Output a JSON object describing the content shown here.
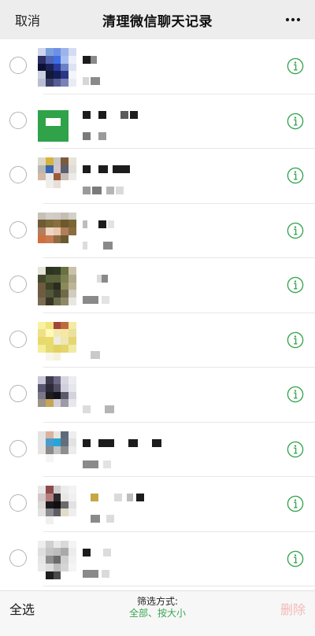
{
  "nav": {
    "cancel_label": "取消",
    "title": "清理微信聊天记录",
    "more_icon": "more-dots-icon"
  },
  "rows": [
    {
      "avatar": [
        "#cfd5ea",
        "#7aa0de",
        "#6f8fe6",
        "#9cb4ea",
        "#d4dcf4",
        "#2c2f62",
        "#5064b0",
        "#3d6ee8",
        "#a7bff0",
        "#edf0fa",
        "#0d1033",
        "#1b2256",
        "#2a3a9e",
        "#6a82c4",
        "#dde3f3",
        "#c9cfdf",
        "#131838",
        "#141d56",
        "#2b3784",
        "#f3f5fa",
        "#b8bfd4",
        "#3a3f68",
        "#565d93",
        "#7a82b6",
        "#e9ecf3"
      ],
      "name_blocks": [
        {
          "x": 0,
          "w": 10,
          "c": "#1c1c1c"
        },
        {
          "x": 10,
          "w": 8,
          "c": "#8a8a8a"
        }
      ],
      "sub_blocks": [
        {
          "x": 0,
          "w": 8,
          "c": "#d6d6d6"
        },
        {
          "x": 10,
          "w": 12,
          "c": "#8a8a8a"
        }
      ]
    },
    {
      "avatar": [
        "#ffffff",
        "#ffffff",
        "#ffffff",
        "#ffffff",
        "#ffffff",
        "#2fa24a",
        "#2fa24a",
        "#2fa24a",
        "#2fa24a",
        "#ffffff",
        "#2fa24a",
        "#ffffff",
        "#ffffff",
        "#2fa24a",
        "#ffffff",
        "#2fa24a",
        "#2fa24a",
        "#2fa24a",
        "#2fa24a",
        "#ffffff",
        "#2fa24a",
        "#2fa24a",
        "#2fa24a",
        "#2fa24a",
        "#ffffff"
      ],
      "name_blocks": [
        {
          "x": 0,
          "w": 10,
          "c": "#1c1c1c"
        },
        {
          "x": 20,
          "w": 10,
          "c": "#1c1c1c"
        },
        {
          "x": 48,
          "w": 10,
          "c": "#5a5a5a"
        },
        {
          "x": 60,
          "w": 10,
          "c": "#1c1c1c"
        }
      ],
      "sub_blocks": [
        {
          "x": 0,
          "w": 10,
          "c": "#7a7a7a"
        },
        {
          "x": 20,
          "w": 10,
          "c": "#9a9a9a"
        }
      ]
    },
    {
      "avatar": [
        "#ddd9c9",
        "#d8b33b",
        "#c7c6c9",
        "#7c5a3c",
        "#e7e3d9",
        "#b8b7b6",
        "#3767b0",
        "#d7c4c8",
        "#5b5f70",
        "#e0dcd6",
        "#d5b8a5",
        "#e8ebeb",
        "#9b5b3a",
        "#c9bfb9",
        "#ebebea",
        "#ffffff",
        "#f0eeea",
        "#e7dfd8",
        "#ffffff",
        "#ffffff",
        "#ffffff",
        "#ffffff",
        "#ffffff",
        "#ffffff",
        "#ffffff"
      ],
      "name_blocks": [
        {
          "x": 0,
          "w": 10,
          "c": "#1c1c1c"
        },
        {
          "x": 20,
          "w": 12,
          "c": "#1c1c1c"
        },
        {
          "x": 38,
          "w": 12,
          "c": "#1c1c1c"
        },
        {
          "x": 50,
          "w": 10,
          "c": "#1c1c1c"
        }
      ],
      "sub_blocks": [
        {
          "x": 0,
          "w": 10,
          "c": "#9a9a9a"
        },
        {
          "x": 12,
          "w": 12,
          "c": "#7a7a7a"
        },
        {
          "x": 30,
          "w": 10,
          "c": "#b5b5b5"
        },
        {
          "x": 42,
          "w": 10,
          "c": "#dadada"
        }
      ]
    },
    {
      "avatar": [
        "#c7c0b6",
        "#d2cdc6",
        "#cfcbc5",
        "#c6bdb2",
        "#d3d0ca",
        "#6e5a33",
        "#7a6a37",
        "#8b6e3e",
        "#6a5a2e",
        "#7a6533",
        "#b17e60",
        "#eed5c4",
        "#e8c8b0",
        "#b27d5b",
        "#8a6c40",
        "#d06e3e",
        "#c57b52",
        "#8e6b42",
        "#6b5a30",
        "#ffffff",
        "#ffffff",
        "#ffffff",
        "#ffffff",
        "#ffffff",
        "#ffffff"
      ],
      "name_blocks": [
        {
          "x": 0,
          "w": 6,
          "c": "#bdbdbd"
        },
        {
          "x": 20,
          "w": 10,
          "c": "#1c1c1c"
        },
        {
          "x": 32,
          "w": 8,
          "c": "#e3e3e3"
        }
      ],
      "sub_blocks": [
        {
          "x": 0,
          "w": 6,
          "c": "#dcdcdc"
        },
        {
          "x": 26,
          "w": 12,
          "c": "#8a8a8a"
        }
      ]
    },
    {
      "avatar": [
        "#e6e3d9",
        "#2b3520",
        "#2f3a22",
        "#6b7043",
        "#c9c2a9",
        "#43482b",
        "#59613c",
        "#5b6039",
        "#7a8050",
        "#b0a98e",
        "#6e5a3e",
        "#3f4326",
        "#2a2d1d",
        "#8a8a5a",
        "#bcb595",
        "#6e5b42",
        "#52593a",
        "#3e3d2a",
        "#6f6a4a",
        "#d1ccbf",
        "#7b6b53",
        "#3b3424",
        "#6a6d4d",
        "#8e8966",
        "#e8e6e1"
      ],
      "name_blocks": [
        {
          "x": 18,
          "w": 6,
          "c": "#dcdcdc"
        },
        {
          "x": 24,
          "w": 8,
          "c": "#8a8a8a"
        }
      ],
      "sub_blocks": [
        {
          "x": 0,
          "w": 20,
          "c": "#8a8a8a"
        },
        {
          "x": 24,
          "w": 10,
          "c": "#e3e3e3"
        }
      ]
    },
    {
      "avatar": [
        "#f8f1a0",
        "#f0e37a",
        "#a0463a",
        "#bf6a3c",
        "#f4e9a5",
        "#ede088",
        "#fff9b7",
        "#f3e9b3",
        "#f6e7a3",
        "#ebe19e",
        "#e9d86a",
        "#eada6c",
        "#f0ecdd",
        "#eee6b3",
        "#e6d673",
        "#f4ee9a",
        "#e5db73",
        "#e1d261",
        "#e4d669",
        "#f1eaa6",
        "#ffffff",
        "#f8f6ea",
        "#f6f2da",
        "#ffffff",
        "#ffffff"
      ],
      "name_blocks": [],
      "sub_blocks": [
        {
          "x": 10,
          "w": 12,
          "c": "#c9c9c9"
        }
      ]
    },
    {
      "avatar": [
        "#c8c6d6",
        "#3f3b4f",
        "#6e6a86",
        "#d9d6e0",
        "#ececf2",
        "#5a5670",
        "#2c2a37",
        "#514e62",
        "#cfd0dc",
        "#e6e6ed",
        "#7a7788",
        "#1d1b24",
        "#141218",
        "#5c5a6a",
        "#d4d3db",
        "#9b9488",
        "#c6a555",
        "#d0d0d6",
        "#9e9ba6",
        "#e8e7ec",
        "#ffffff",
        "#ffffff",
        "#ffffff",
        "#ffffff",
        "#ffffff"
      ],
      "name_blocks": [],
      "sub_blocks": [
        {
          "x": 0,
          "w": 10,
          "c": "#dcdcdc"
        },
        {
          "x": 28,
          "w": 12,
          "c": "#b5b5b5"
        }
      ]
    },
    {
      "avatar": [
        "#e3e3e3",
        "#d9b39e",
        "#e9e3de",
        "#5e6a7a",
        "#eeeeee",
        "#e4e4e6",
        "#4a9bcf",
        "#24a6d8",
        "#636e7e",
        "#e2e2e2",
        "#e6e3e0",
        "#8a8a8a",
        "#c2c2c2",
        "#8e8e8e",
        "#ececec",
        "#ffffff",
        "#f5f5f5",
        "#ffffff",
        "#ffffff",
        "#ffffff",
        "#ffffff",
        "#ffffff",
        "#ffffff",
        "#ffffff",
        "#ffffff"
      ],
      "name_blocks": [
        {
          "x": 0,
          "w": 10,
          "c": "#1c1c1c"
        },
        {
          "x": 20,
          "w": 20,
          "c": "#1c1c1c"
        },
        {
          "x": 58,
          "w": 12,
          "c": "#1c1c1c"
        },
        {
          "x": 88,
          "w": 12,
          "c": "#1c1c1c"
        }
      ],
      "sub_blocks": [
        {
          "x": 0,
          "w": 20,
          "c": "#8a8a8a"
        },
        {
          "x": 26,
          "w": 10,
          "c": "#e3e3e3"
        }
      ]
    },
    {
      "avatar": [
        "#e8e8e8",
        "#8d4a4a",
        "#cfcfcf",
        "#ececec",
        "#f3f3f3",
        "#d2c8c8",
        "#b47d7d",
        "#2b2a2e",
        "#ebe6e1",
        "#f0f0f0",
        "#dad7d4",
        "#1a1a1e",
        "#0f0f12",
        "#6b6a6f",
        "#e2e2e2",
        "#e4e2e0",
        "#8c8b8f",
        "#5e5d63",
        "#e1dcc8",
        "#eeeeee",
        "#ffffff",
        "#f0f0f0",
        "#ffffff",
        "#ffffff",
        "#ffffff"
      ],
      "name_blocks": [
        {
          "x": 10,
          "w": 10,
          "c": "#c4a843"
        },
        {
          "x": 40,
          "w": 10,
          "c": "#dadada"
        },
        {
          "x": 56,
          "w": 8,
          "c": "#bdbdbd"
        },
        {
          "x": 68,
          "w": 10,
          "c": "#1c1c1c"
        }
      ],
      "sub_blocks": [
        {
          "x": 10,
          "w": 12,
          "c": "#8a8a8a"
        },
        {
          "x": 30,
          "w": 10,
          "c": "#dcdcdc"
        }
      ]
    },
    {
      "avatar": [
        "#eeeeee",
        "#cfcfcf",
        "#e9e9e9",
        "#d9d9d9",
        "#f4f4f4",
        "#dedede",
        "#c4c4c4",
        "#bdbdbd",
        "#a9a9a9",
        "#ececec",
        "#e5e5e5",
        "#8e8e8e",
        "#6b6b6b",
        "#cfcfcf",
        "#f1f1f1",
        "#e9e9e9",
        "#dcdcdc",
        "#bebebe",
        "#d5d5d5",
        "#f5f5f5",
        "#ffffff",
        "#1e1e1e",
        "#4a4a4a",
        "#ffffff",
        "#ffffff"
      ],
      "name_blocks": [
        {
          "x": 0,
          "w": 10,
          "c": "#1c1c1c"
        },
        {
          "x": 26,
          "w": 10,
          "c": "#dcdcdc"
        }
      ],
      "sub_blocks": [
        {
          "x": 0,
          "w": 20,
          "c": "#8a8a8a"
        },
        {
          "x": 24,
          "w": 10,
          "c": "#dadada"
        }
      ]
    }
  ],
  "bottom": {
    "select_all_label": "全选",
    "filter_label": "筛选方式:",
    "filter_value": "全部、按大小",
    "delete_label": "删除"
  },
  "colors": {
    "accent_green": "#3aa653",
    "delete_disabled": "#f5b9b9"
  }
}
